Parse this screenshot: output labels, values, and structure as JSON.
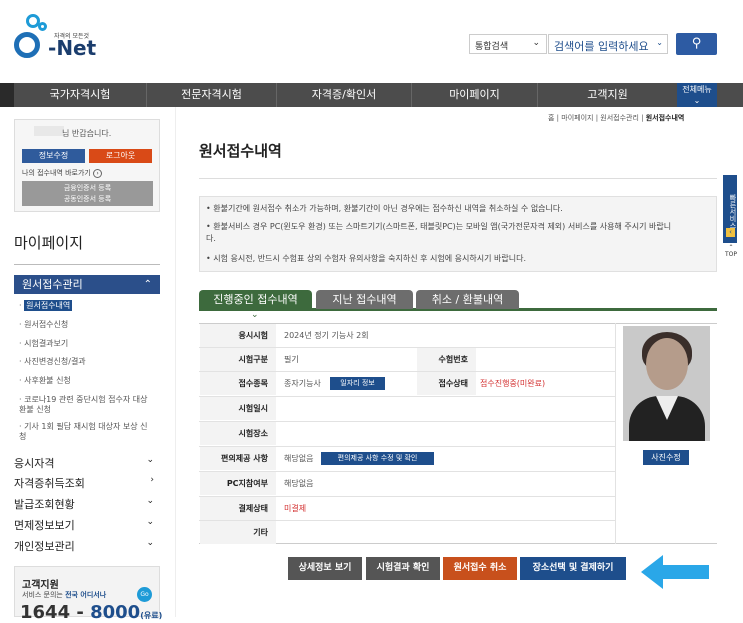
{
  "header": {
    "logo_tagline": "자격의 모든것",
    "logo_text": "Net",
    "search_type": "통합검색",
    "search_placeholder": "검색어를 입력하세요",
    "search_icon": "search-icon"
  },
  "nav": {
    "items": [
      "국가자격시험",
      "전문자격시험",
      "자격증/확인서",
      "마이페이지",
      "고객지원"
    ],
    "all_menu": "전체메뉴"
  },
  "sidebar": {
    "greeting": "님 반갑습니다.",
    "btn_info": "정보수정",
    "btn_logout": "로그아웃",
    "recent": "나의 접수내역 바로가기",
    "cert_line1": "금융인증서 등록",
    "cert_line2": "공동인증서 등록",
    "title": "마이페이지",
    "menu_head": "원서접수관리",
    "sub_items": [
      "원서접수내역",
      "원서접수신청",
      "시험결과보기",
      "사진변경신청/결과",
      "사후환불 신청",
      "코로나19 관련 중단시험 접수자 대상 환불 신청",
      "기사 1회 필답 재시험 대상자 보상 신청"
    ],
    "groups": [
      "응시자격",
      "자격증취득조회",
      "발급조회현황",
      "면제정보보기",
      "개인정보관리"
    ],
    "cs_title": "고객지원",
    "cs_desc": "서비스 문의는",
    "cs_desc_bold": "전국 어디서나",
    "cs_go": "Go",
    "cs_phone_a": "1644 - ",
    "cs_phone_b": "8000",
    "cs_phone_c": "(유료)"
  },
  "main": {
    "breadcrumb": [
      "홈",
      "마이페이지",
      "원서접수관리"
    ],
    "breadcrumb_current": "원서접수내역",
    "title": "원서접수내역",
    "notices": [
      "환불기간에 원서접수 취소가 가능하며, 환불기간이 아닌 경우에는 접수하신 내역을 취소하실 수 없습니다.",
      "환불서비스 경우 PC(윈도우 환경) 또는 스마트기기(스마트폰, 태블릿PC)는 모바일 앱(국가전문자격 제외) 서비스를 사용해 주시기 바랍니다.",
      "시험 응시전, 반드시 수험표 상의 수험자 유의사항을 숙지하신 후 시험에 응시하시기 바랍니다."
    ],
    "quick_menu": "빠른서비스",
    "top_label": "TOP",
    "tabs": [
      "진행중인 접수내역",
      "지난 접수내역",
      "취소 / 환불내역"
    ]
  },
  "table": {
    "labels": [
      "응시시험",
      "시험구분",
      "접수종목",
      "시험일시",
      "시험장소",
      "편의제공 사항",
      "PC지참여부",
      "결제상태",
      "기타"
    ],
    "exam": "2024년 정기 기능사 2회",
    "exam_type": "필기",
    "exam_number_label": "수험번호",
    "exam_number": "",
    "subject": "종자기능사",
    "job_btn": "일자리 정보",
    "status_label": "접수상태",
    "status": "접수진행중(미완료)",
    "exam_datetime": "",
    "exam_place": "",
    "convenience": "해당없음",
    "convenience_btn": "편의제공 사항 수정 및 확인",
    "pc": "해당없음",
    "payment": "미결제",
    "etc": "",
    "photo_btn": "사진수정"
  },
  "buttons": {
    "detail": "상세정보 보기",
    "result": "시험결과 확인",
    "cancel": "원서접수 취소",
    "pay": "장소선택 및 결제하기"
  },
  "colors": {
    "brand": "#1e4e8c",
    "tab_active": "#3d6a3d",
    "cancel": "#c8501c",
    "alert": "#d32f2f",
    "arrow": "#2aa7e8"
  }
}
